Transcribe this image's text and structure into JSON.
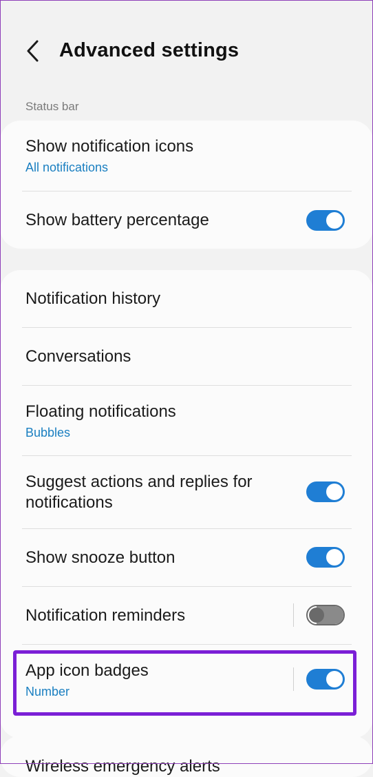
{
  "header": {
    "title": "Advanced settings",
    "back_icon": "chevron-left-icon"
  },
  "status_bar_section": {
    "label": "Status bar",
    "items": [
      {
        "title": "Show notification icons",
        "subtitle": "All notifications"
      },
      {
        "title": "Show battery percentage",
        "toggle": "on"
      }
    ]
  },
  "notification_section": {
    "items": [
      {
        "title": "Notification history"
      },
      {
        "title": "Conversations"
      },
      {
        "title": "Floating notifications",
        "subtitle": "Bubbles"
      },
      {
        "title_line1": "Suggest actions and replies for",
        "title_line2": "notifications",
        "toggle": "on"
      },
      {
        "title": "Show snooze button",
        "toggle": "on"
      },
      {
        "title": "Notification reminders",
        "toggle": "off"
      },
      {
        "title": "App icon badges",
        "subtitle": "Number",
        "toggle": "on"
      }
    ]
  },
  "next_section": {
    "partial_title": "Wireless emergency alerts"
  },
  "colors": {
    "accent": "#1f7ed4",
    "subtitle": "#1a7fc1",
    "highlight": "#7b1fd6",
    "background": "#f2f2f2"
  }
}
